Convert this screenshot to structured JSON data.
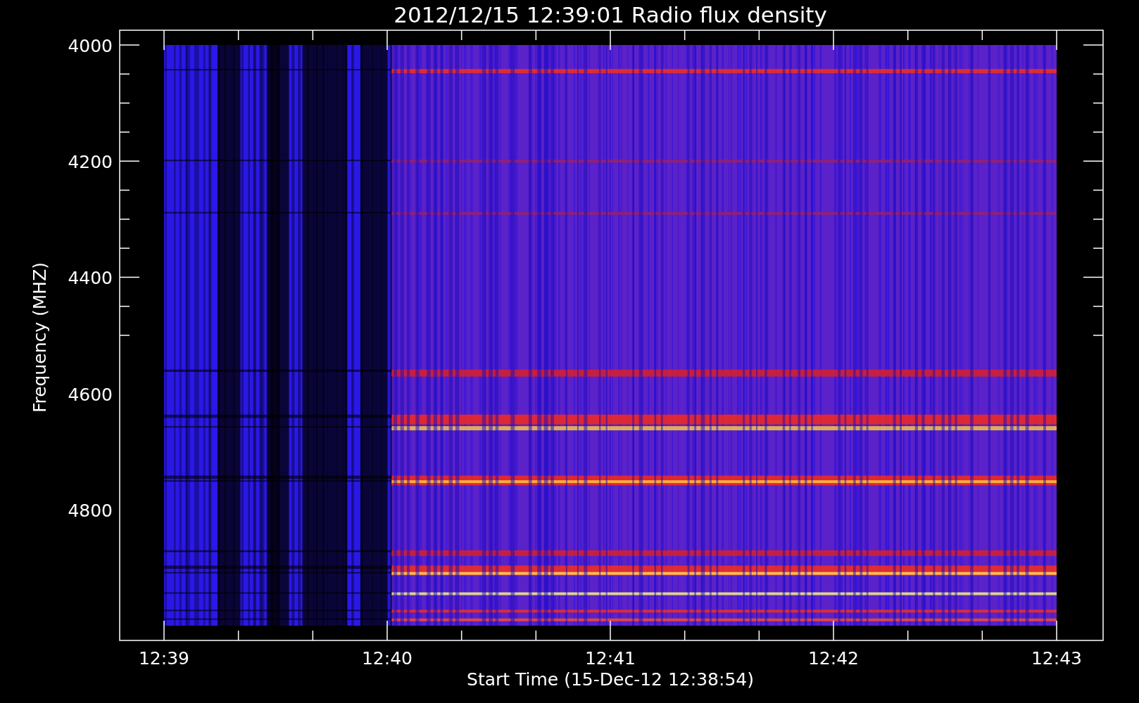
{
  "title": "2012/12/15 12:39:01 Radio flux density",
  "plot": {
    "ylabel": "Frequency (MHZ)",
    "xlabel": "Start Time (15-Dec-12 12:38:54)",
    "yticks": [
      "4000",
      "4200",
      "4400",
      "4600",
      "4800"
    ],
    "xticks": [
      "12:39",
      "12:40",
      "12:41",
      "12:42",
      "12:43"
    ]
  }
}
